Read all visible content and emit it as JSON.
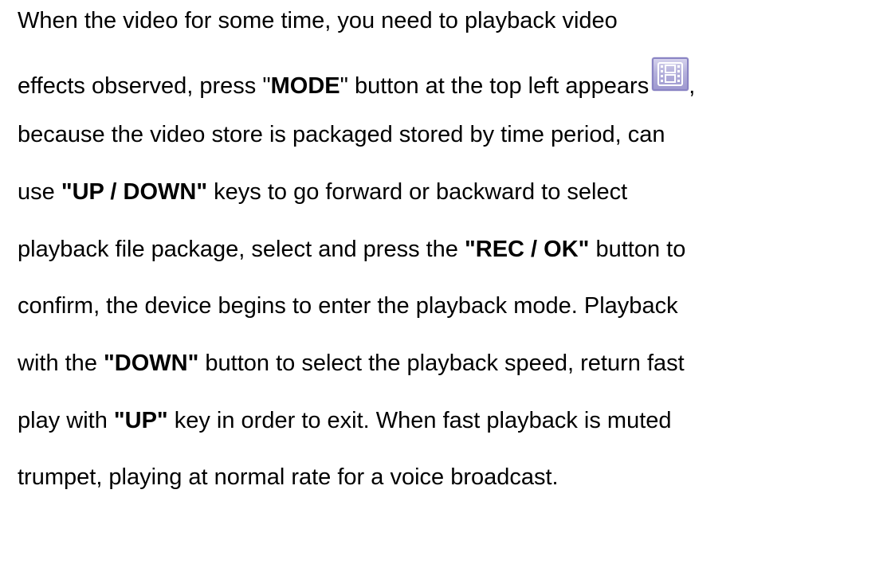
{
  "paragraph": {
    "line1": "When the video for some time, you need to playback video",
    "line2_pre": "effects observed, press \"",
    "line2_key": "MODE",
    "line2_mid": "\" button at the top left appears",
    "line2_post": ",",
    "line3": "because the video store is packaged stored by time period, can",
    "line4_pre": "use ",
    "line4_key": "\"UP / DOWN\"",
    "line4_post": " keys to go forward or backward to select",
    "line5_pre": "playback file package, select and press the ",
    "line5_key": "\"REC / OK\"",
    "line5_post": " button to",
    "line6": "confirm, the device begins to enter the playback mode. Playback",
    "line7_pre": "with the ",
    "line7_key": "\"DOWN\"",
    "line7_post": " button to select the playback speed, return fast",
    "line8_pre": "play with ",
    "line8_key": "\"UP\"",
    "line8_post": " key in order to exit. When fast playback is muted",
    "line9": "trumpet, playing at normal rate for a voice broadcast."
  },
  "icons": {
    "playback_mode_icon": "film-strip-playback-icon"
  }
}
